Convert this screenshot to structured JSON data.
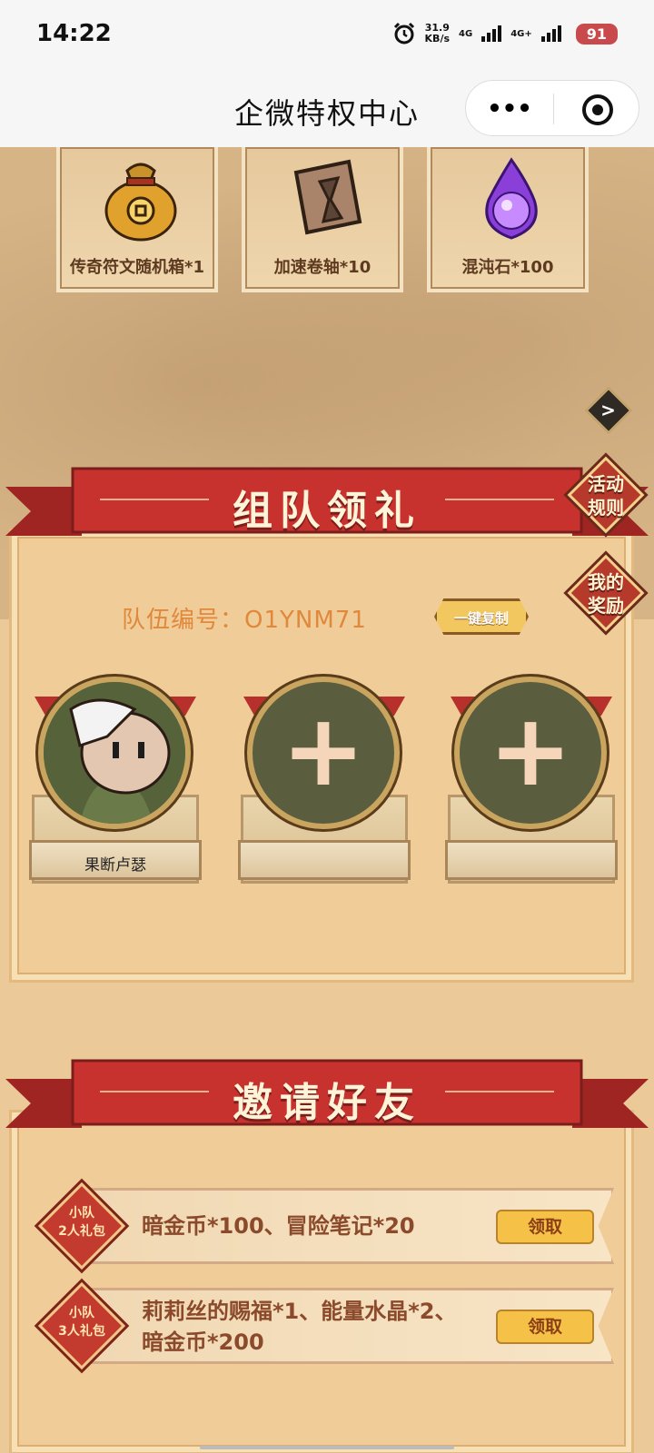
{
  "status_bar": {
    "time": "14:22",
    "speed_value": "31.9",
    "speed_unit": "KB/s",
    "net1": "4G",
    "net2": "4G+",
    "battery": "91"
  },
  "header": {
    "title": "企微特权中心",
    "more_label": "•••"
  },
  "rewards": [
    {
      "name": "传奇符文随机箱*1",
      "icon": "gold-bag-icon"
    },
    {
      "name": "加速卷轴*10",
      "icon": "scroll-hourglass-icon"
    },
    {
      "name": "混沌石*100",
      "icon": "purple-flame-orb-icon"
    }
  ],
  "arrow_label": ">",
  "team_section": {
    "title": "组队领礼",
    "rules_label": "活动\n规则",
    "my_rewards_label": "我的\n奖励",
    "team_number": "队伍编号：O1YNM71",
    "copy_label": "一键复制",
    "members": [
      {
        "name": "果断卢瑟",
        "filled": true
      },
      {
        "name": "",
        "filled": false
      },
      {
        "name": "",
        "filled": false
      }
    ],
    "add_symbol": "+"
  },
  "invite_section": {
    "title": "邀请好友",
    "gifts": [
      {
        "badge": "小队\n2人礼包",
        "reward": "暗金币*100、冒险笔记*20",
        "button": "领取"
      },
      {
        "badge": "小队\n3人礼包",
        "reward": "莉莉丝的赐福*1、能量水晶*2、\n暗金币*200",
        "button": "领取"
      }
    ]
  },
  "colors": {
    "ribbon_red": "#c8322e",
    "gold": "#f5c147",
    "panel_bg": "#f0cd98",
    "orange_text": "#e0883c"
  }
}
